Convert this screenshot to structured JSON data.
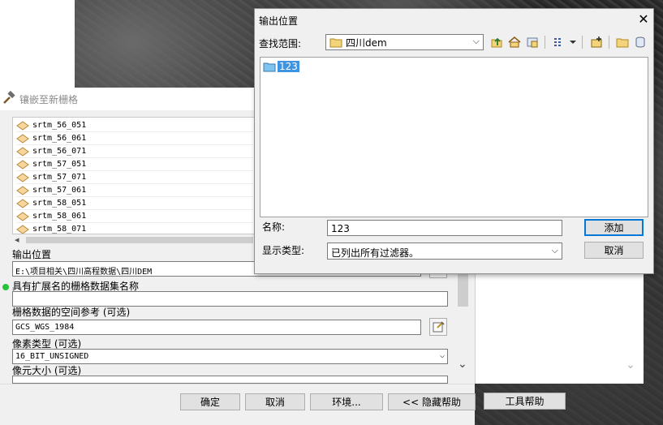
{
  "tool_dialog": {
    "title": "镶嵌至新栅格",
    "rasters": [
      "srtm_56_051",
      "srtm_56_061",
      "srtm_56_071",
      "srtm_57_051",
      "srtm_57_071",
      "srtm_57_061",
      "srtm_58_051",
      "srtm_58_061",
      "srtm_58_071"
    ],
    "output_location_label": "输出位置",
    "output_location_value": "E:\\项目相关\\四川高程数据\\四川DEM",
    "dataset_name_label": "具有扩展名的栅格数据集名称",
    "dataset_name_value": "",
    "spatial_ref_label": "栅格数据的空间参考 (可选)",
    "spatial_ref_value": "GCS_WGS_1984",
    "pixel_type_label": "像素类型 (可选)",
    "pixel_type_value": "16_BIT_UNSIGNED",
    "cell_size_label": "像元大小 (可选)",
    "buttons": {
      "ok": "确定",
      "cancel": "取消",
      "env": "环境...",
      "hide_help": "<< 隐藏帮助",
      "tool_help": "工具帮助"
    }
  },
  "save_dialog": {
    "title": "输出位置",
    "look_in_label": "查找范围:",
    "look_in_value": "四川dem",
    "items": [
      "123"
    ],
    "name_label": "名称:",
    "name_value": "123",
    "type_label": "显示类型:",
    "type_value": "已列出所有过滤器。",
    "add_button": "添加",
    "cancel_button": "取消"
  }
}
